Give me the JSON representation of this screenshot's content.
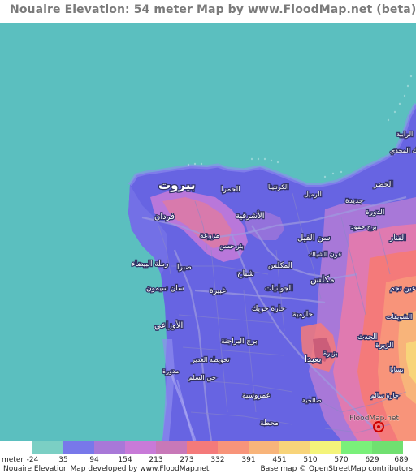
{
  "title": "Nouaire Elevation: 54 meter Map by www.FloodMap.net (beta)",
  "legend": {
    "unit": "meter",
    "ticks": [
      "-24",
      "35",
      "94",
      "154",
      "213",
      "273",
      "332",
      "391",
      "451",
      "510",
      "570",
      "629",
      "689"
    ],
    "colors": [
      "#7bcfc4",
      "#7878ea",
      "#a878d8",
      "#c87ad8",
      "#c878b8",
      "#f47a7a",
      "#f8947a",
      "#f8b47a",
      "#f8d47a",
      "#f4f47a",
      "#7af07a",
      "#70e070"
    ]
  },
  "footer": {
    "left": "Nouaire Elevation Map developed by www.FloodMap.net",
    "right": "Base map © OpenStreetMap contributors"
  },
  "map": {
    "water_color": "#5bbfbf",
    "low_color": "#6a68e0",
    "labels": [
      {
        "text": "بيروت",
        "kind": "city"
      },
      {
        "text": "فردان",
        "kind": "district"
      },
      {
        "text": "مزرعة",
        "kind": "district"
      },
      {
        "text": "الأشرفية",
        "kind": "district"
      },
      {
        "text": "سن الفيل",
        "kind": "district"
      },
      {
        "text": "الحمرا",
        "kind": "district"
      },
      {
        "text": "صبرا",
        "kind": "district"
      },
      {
        "text": "شياح",
        "kind": "district"
      },
      {
        "text": "المكلس",
        "kind": "district"
      },
      {
        "text": "مكلس",
        "kind": "district"
      },
      {
        "text": "الجوانيات",
        "kind": "district"
      },
      {
        "text": "غبيرة",
        "kind": "district"
      },
      {
        "text": "حارة حريك",
        "kind": "district"
      },
      {
        "text": "برج البراجنة",
        "kind": "district"
      },
      {
        "text": "بعبدا",
        "kind": "district"
      },
      {
        "text": "جديدة",
        "kind": "district"
      },
      {
        "text": "الفنار",
        "kind": "district"
      },
      {
        "text": "الزيرة",
        "kind": "district"
      },
      {
        "text": "عين نجم",
        "kind": "district"
      },
      {
        "text": "الشويفات",
        "kind": "district"
      },
      {
        "text": "حازمية",
        "kind": "district"
      },
      {
        "text": "الحدث",
        "kind": "district"
      },
      {
        "text": "عمروسية",
        "kind": "district"
      },
      {
        "text": "محطة",
        "kind": "district"
      },
      {
        "text": "رملة البيضاء",
        "kind": "district"
      },
      {
        "text": "الأوزاعي",
        "kind": "district"
      },
      {
        "text": "بئر حسن",
        "kind": "district"
      },
      {
        "text": "صالحية",
        "kind": "district"
      },
      {
        "text": "جارة سالم",
        "kind": "district"
      },
      {
        "text": "الكرنتينا",
        "kind": "district"
      },
      {
        "text": "الخضر",
        "kind": "district"
      },
      {
        "text": "الرميل",
        "kind": "district"
      },
      {
        "text": "الدورة",
        "kind": "district"
      },
      {
        "text": "الرابية",
        "kind": "district"
      },
      {
        "text": "ديك المحدي",
        "kind": "district"
      },
      {
        "text": "تحويطة الغدير",
        "kind": "district"
      },
      {
        "text": "برج حمود",
        "kind": "district"
      },
      {
        "text": "فرن الشباك",
        "kind": "district"
      },
      {
        "text": "بزيرة",
        "kind": "district"
      },
      {
        "text": "بسابا",
        "kind": "district"
      },
      {
        "text": "حي السلم",
        "kind": "district"
      },
      {
        "text": "مدورة",
        "kind": "district"
      },
      {
        "text": "سان سيمون",
        "kind": "district"
      }
    ],
    "watermark": "FloodMap.net"
  }
}
